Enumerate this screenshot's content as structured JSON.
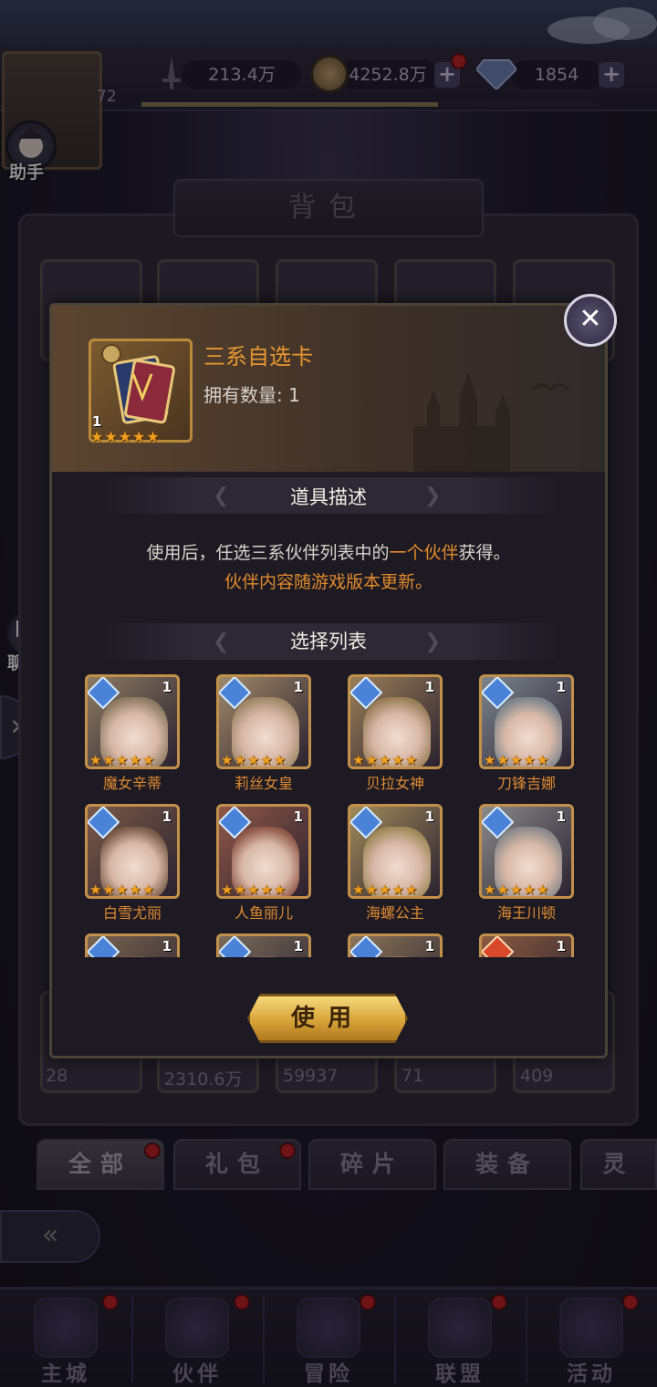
{
  "top_bar": {
    "avatar_level": "72",
    "power": "213.4万",
    "gold": "4252.8万",
    "diamonds": "1854"
  },
  "side": {
    "assistant_label": "助手",
    "chat_label": "聊 天"
  },
  "backpack": {
    "title": "背包",
    "slot_counts": [
      "28",
      "2310.6万",
      "59937",
      "71",
      "409"
    ],
    "tabs": [
      "全部",
      "礼包",
      "碎片",
      "装备",
      "灵"
    ]
  },
  "item_popup": {
    "name": "三系自选卡",
    "owned_label": "拥有数量: 1",
    "item_qty": "1",
    "desc_section": "道具描述",
    "desc_line1_a": "使用后，任选三系伙伴列表中的",
    "desc_line1_hl": "一个伙伴",
    "desc_line1_b": "获得。",
    "desc_line2": "伙伴内容随游戏版本更新。",
    "list_section": "选择列表",
    "heroes": [
      {
        "name": "魔女辛蒂",
        "level": "1",
        "element": "water",
        "color": "#8c7a62"
      },
      {
        "name": "莉丝女皇",
        "level": "1",
        "element": "water",
        "color": "#a08868"
      },
      {
        "name": "贝拉女神",
        "level": "1",
        "element": "water",
        "color": "#9a7e58"
      },
      {
        "name": "刀锋吉娜",
        "level": "1",
        "element": "water",
        "color": "#7c848c"
      },
      {
        "name": "白雪尤丽",
        "level": "1",
        "element": "water",
        "color": "#7a5a48"
      },
      {
        "name": "人鱼丽儿",
        "level": "1",
        "element": "water",
        "color": "#905848"
      },
      {
        "name": "海螺公主",
        "level": "1",
        "element": "water",
        "color": "#a08a5a"
      },
      {
        "name": "海王川顿",
        "level": "1",
        "element": "water",
        "color": "#8a8a8a"
      },
      {
        "name": "",
        "level": "1",
        "element": "water",
        "color": "#7a6450"
      },
      {
        "name": "",
        "level": "1",
        "element": "water",
        "color": "#7a6a58"
      },
      {
        "name": "",
        "level": "1",
        "element": "water",
        "color": "#8a7458"
      },
      {
        "name": "",
        "level": "1",
        "element": "fire",
        "color": "#8a5a40"
      }
    ],
    "use_button": "使用",
    "close_icon": "close-icon"
  },
  "bottom_nav": [
    "主城",
    "伙伴",
    "冒险",
    "联盟",
    "活动"
  ],
  "colors": {
    "accent_orange": "#e38a2a",
    "gold_button": "#d8a43a",
    "badge_red": "#c41f1f"
  }
}
